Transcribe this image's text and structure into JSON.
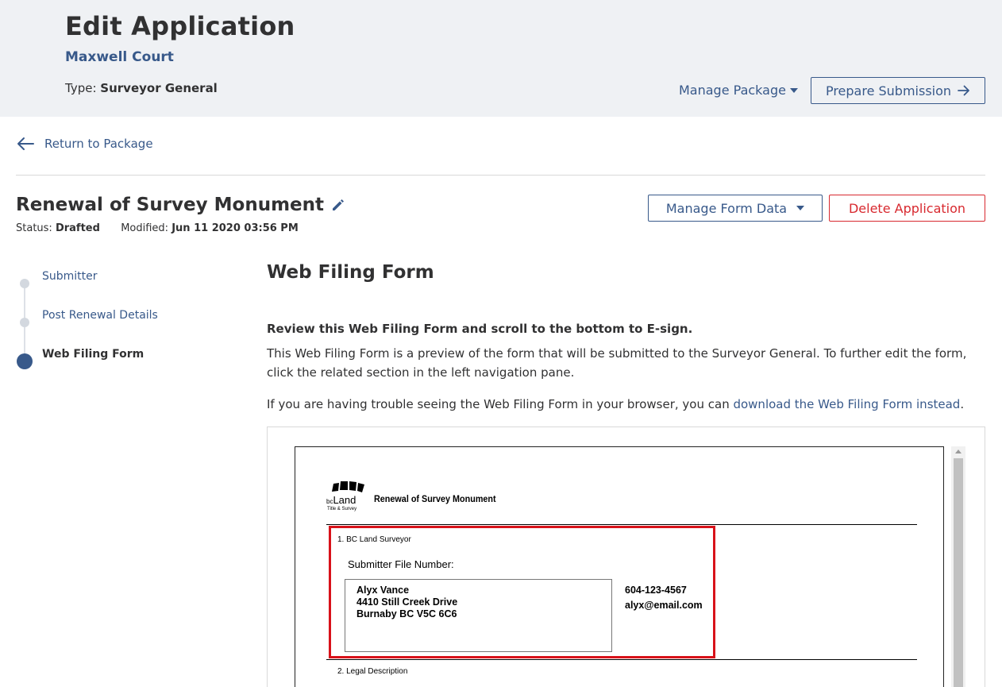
{
  "header": {
    "title": "Edit Application",
    "subtitle": "Maxwell Court",
    "type_label": "Type:",
    "type_value": "Surveyor General",
    "manage_package_label": "Manage Package",
    "prepare_submission_label": "Prepare Submission"
  },
  "nav": {
    "return_label": "Return to Package"
  },
  "form_header": {
    "title": "Renewal of Survey Monument",
    "status_label": "Status:",
    "status_value": "Drafted",
    "modified_label": "Modified:",
    "modified_value": "Jun 11 2020 03:56 PM",
    "manage_form_data_label": "Manage Form Data",
    "delete_label": "Delete Application"
  },
  "steps": [
    {
      "label": "Submitter",
      "active": false
    },
    {
      "label": "Post Renewal Details",
      "active": false
    },
    {
      "label": "Web Filing Form",
      "active": true
    }
  ],
  "main": {
    "section_title": "Web Filing Form",
    "review_heading": "Review this Web Filing Form and scroll to the bottom to E-sign.",
    "review_text": "This Web Filing Form is a preview of the form that will be submitted to the Surveyor General. To further edit the form, click the related section in the left navigation pane.",
    "trouble_prefix": "If you are having trouble seeing the Web Filing Form in your browser, you can ",
    "trouble_link": "download the Web Filing Form instead",
    "trouble_suffix": "."
  },
  "preview": {
    "logo_bc": "bc",
    "logo_land": "Land",
    "logo_sub": "Title & Survey",
    "doc_title": "Renewal of Survey Monument",
    "section1_label": "1. BC Land Surveyor",
    "submitter_file_label": "Submitter File Number:",
    "address_lines": [
      "Alyx Vance",
      "4410 Still Creek Drive",
      "Burnaby BC V5C 6C6"
    ],
    "phone": "604-123-4567",
    "email": "alyx@email.com",
    "section2_label": "2. Legal Description"
  },
  "colors": {
    "primary": "#38598a",
    "danger": "#d8292f",
    "header_bg": "#eff1f4",
    "highlight": "#d8121a"
  }
}
